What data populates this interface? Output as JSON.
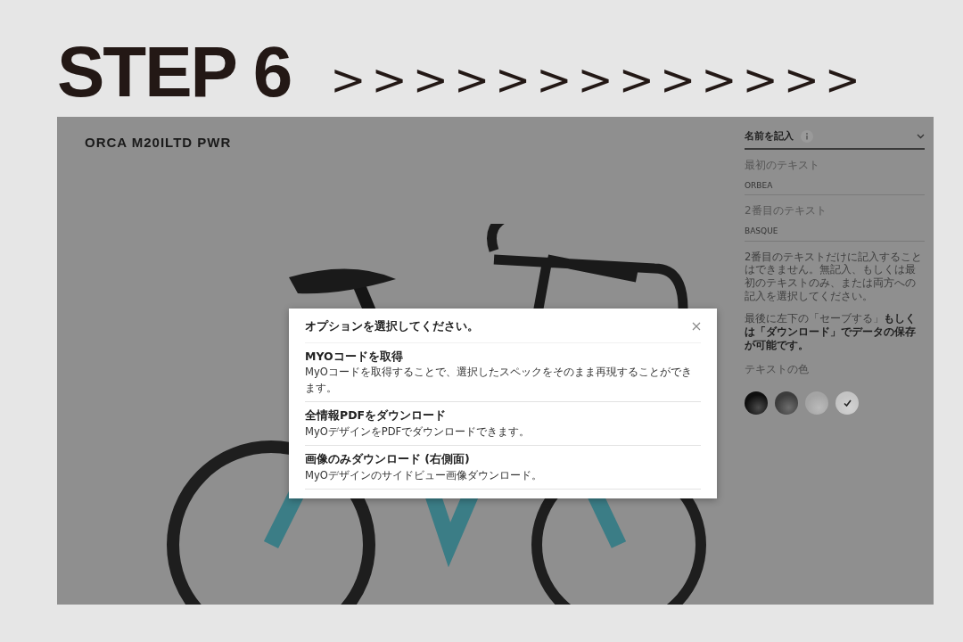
{
  "header": {
    "title": "STEP 6",
    "arrows": ">>>>>>>>>>>>>"
  },
  "product": {
    "name": "ORCA M20ILTD PWR"
  },
  "panel": {
    "section_title": "名前を記入",
    "fields": [
      {
        "label": "最初のテキスト",
        "value": "ORBEA"
      },
      {
        "label": "2番目のテキスト",
        "value": "BASQUE"
      }
    ],
    "note": [
      "2番目のテキストだけに記入することはできません。無記入、もしくは最初のテキストのみ、または両方への記入を選択してください。",
      "最後に左下の「セーブする」**もしくは「ダウンロード」でデータの保存が可能です。**"
    ],
    "color_title": "テキストの色",
    "colors": [
      {
        "color": "#0e0e0e",
        "selected": false
      },
      {
        "color": "#3c3c3c",
        "selected": false
      },
      {
        "color": "#a4a4a4",
        "selected": false
      },
      {
        "color": "#c4c4c4",
        "selected": true
      }
    ]
  },
  "dialog": {
    "title": "オプションを選択してください。",
    "options": [
      {
        "title": "MYOコードを取得",
        "description": "MyOコードを取得することで、選択したスペックをそのまま再現することができます。"
      },
      {
        "title": "全情報PDFをダウンロード",
        "description": "MyOデザインをPDFでダウンロードできます。"
      },
      {
        "title": "画像のみダウンロード (右側面)",
        "description": "MyOデザインのサイドビュー画像ダウンロード。"
      }
    ]
  }
}
